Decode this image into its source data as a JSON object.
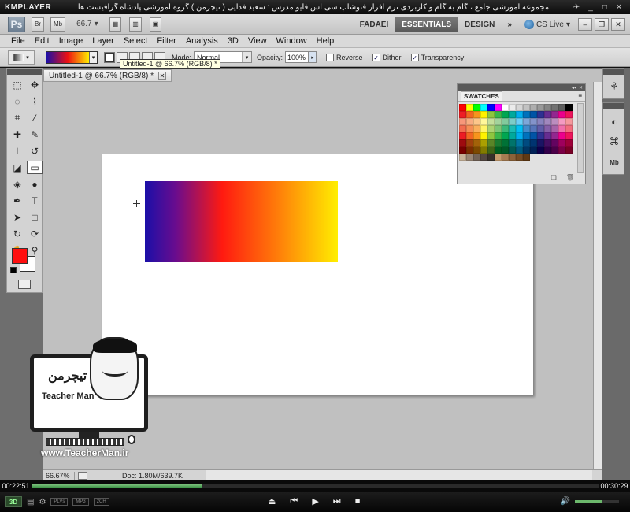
{
  "player": {
    "logo": "KMPLAYER",
    "caption": "مجموعه آموزشی جامع ، گام به گام و کاربردی نرم افزار فتوشاپ سی اس فایو  مدرس : سعید فدایی ( تیچرمن ) گروه آموزشی پادشاه گرافیست ها",
    "elapsed": "00:22:51",
    "total": "00:30:29",
    "progress_fraction": 0.3,
    "volume_fraction": 0.6,
    "badge_3d": "3D",
    "tags": [
      "PLVs",
      "MP3",
      "2CH"
    ],
    "win_controls": [
      "✈",
      "_",
      "□",
      "✕"
    ]
  },
  "appbar": {
    "logo": "Ps",
    "btn_br": "Br",
    "btn_mb": "Mb",
    "zoom": "66.7",
    "workspaces": [
      "FADAEI",
      "ESSENTIALS",
      "DESIGN"
    ],
    "more": "»",
    "cs_live": "CS Live"
  },
  "menu": [
    "File",
    "Edit",
    "Image",
    "Layer",
    "Select",
    "Filter",
    "Analysis",
    "3D",
    "View",
    "Window",
    "Help"
  ],
  "options": {
    "mode_label": "Mode:",
    "mode_value": "Normal",
    "opacity_label": "Opacity:",
    "opacity_value": "100%",
    "reverse_label": "Reverse",
    "dither_label": "Dither",
    "transparency_label": "Transparency",
    "reverse_checked": false,
    "dither_checked": true,
    "transparency_checked": true
  },
  "document": {
    "tab_title": "Untitled-1 @ 66.7% (RGB/8) *",
    "tooltip": "Untitled-1 @ 66.7% (RGB/8) *",
    "status_zoom": "66.67%",
    "status_doc": "Doc: 1.80M/639.7K"
  },
  "swatches": {
    "tab_label": "SWATCHES",
    "colors": [
      "#ff0000",
      "#ffff00",
      "#00ff00",
      "#00ffff",
      "#0000ff",
      "#ff00ff",
      "#ffffff",
      "#ebebeb",
      "#d6d6d6",
      "#c2c2c2",
      "#adadad",
      "#999999",
      "#858585",
      "#707070",
      "#5c5c5c",
      "#000000",
      "#ee1d24",
      "#f26522",
      "#f7941d",
      "#fff200",
      "#8dc63f",
      "#39b54a",
      "#00a651",
      "#00a99d",
      "#00aeef",
      "#0072bc",
      "#0054a6",
      "#2e3192",
      "#662d91",
      "#92278f",
      "#ec008c",
      "#ed145b",
      "#f7977a",
      "#f9ad81",
      "#fdc68a",
      "#fff79a",
      "#c4df9b",
      "#a3d39c",
      "#82ca9d",
      "#7bcdc8",
      "#6dcff6",
      "#7da7d9",
      "#8393ca",
      "#8882be",
      "#a187be",
      "#bc8dbf",
      "#f49ac2",
      "#f6989d",
      "#f26c4f",
      "#f68e55",
      "#fbaf5c",
      "#fff467",
      "#acd372",
      "#7cc576",
      "#3bb878",
      "#1abbb4",
      "#00bff3",
      "#438ccb",
      "#5574b9",
      "#605ca8",
      "#855fa8",
      "#a763a8",
      "#f06eaa",
      "#f26d7d",
      "#ed1c24",
      "#f26522",
      "#f7941d",
      "#fff200",
      "#8dc63f",
      "#39b54a",
      "#00a651",
      "#00a99d",
      "#00aeef",
      "#0072bc",
      "#0054a6",
      "#2e3192",
      "#662d91",
      "#92278f",
      "#ec008c",
      "#ed145b",
      "#9e0b0f",
      "#a0410d",
      "#a36209",
      "#aba000",
      "#598527",
      "#1a7b30",
      "#007236",
      "#00746b",
      "#0076a3",
      "#004b80",
      "#003471",
      "#1b1464",
      "#440e62",
      "#630460",
      "#9e005d",
      "#9e0039",
      "#790000",
      "#7b2e00",
      "#7d4900",
      "#827b00",
      "#406618",
      "#005e20",
      "#005826",
      "#005952",
      "#005b7f",
      "#003663",
      "#002157",
      "#0d004c",
      "#32004b",
      "#4b0049",
      "#7b0046",
      "#7a0026",
      "#c7b299",
      "#998675",
      "#736357",
      "#534741",
      "#37302a",
      "#c69c6d",
      "#a67c52",
      "#8c6239",
      "#754c24",
      "#603913"
    ]
  },
  "watermark": {
    "persian_logo": "تیچرمن",
    "name": "Teacher Man",
    "url": "www.TeacherMan.ir"
  },
  "icons": {
    "tools": [
      "marquee-icon",
      "move-icon",
      "lasso-icon",
      "quick-select-icon",
      "crop-icon",
      "eyedropper-icon",
      "healing-icon",
      "brush-icon",
      "stamp-icon",
      "history-brush-icon",
      "eraser-icon",
      "gradient-icon",
      "blur-icon",
      "dodge-icon",
      "pen-icon",
      "type-icon",
      "path-select-icon",
      "shape-icon",
      "3d-rotate-icon",
      "3d-orbit-icon",
      "hand-icon",
      "zoom-icon"
    ],
    "tool_glyphs": [
      "⬚",
      "✥",
      "◌",
      "⌇",
      "⌗",
      "⁄",
      "✚",
      "✎",
      "⊥",
      "↺",
      "◪",
      "▭",
      "◈",
      "●",
      "✒",
      "T",
      "➤",
      "□",
      "↻",
      "⟳",
      "✋",
      "⚲"
    ],
    "dock": [
      "⚘",
      "◐",
      "⌘",
      "Mb"
    ]
  },
  "colors": {
    "foreground": "#ff0f0f",
    "background": "#ffffff",
    "gradient_start": "#1a0fa8",
    "gradient_mid": "#ff1a10",
    "gradient_end": "#ffee00"
  }
}
